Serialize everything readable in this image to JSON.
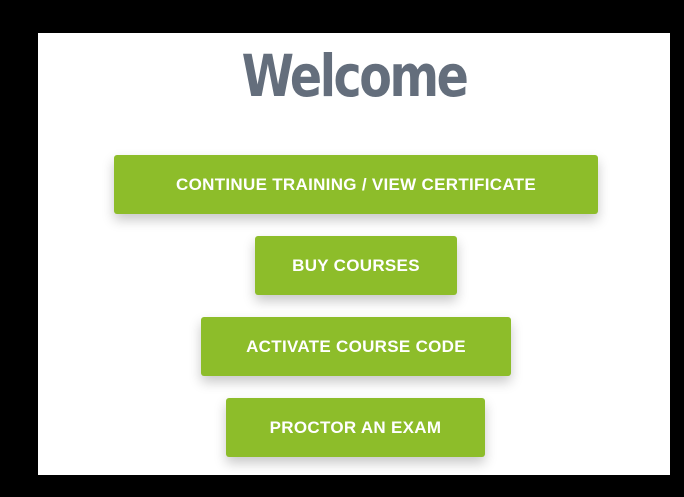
{
  "page": {
    "title": "Welcome",
    "colors": {
      "title": "#646e7c",
      "button_bg": "#8dbd2a",
      "button_text": "#ffffff",
      "frame_border": "#000000",
      "panel_bg": "#ffffff"
    }
  },
  "buttons": {
    "continue_training": "CONTINUE TRAINING / VIEW CERTIFICATE",
    "buy_courses": "BUY COURSES",
    "activate_course_code": "ACTIVATE COURSE CODE",
    "proctor_exam": "PROCTOR AN EXAM"
  }
}
